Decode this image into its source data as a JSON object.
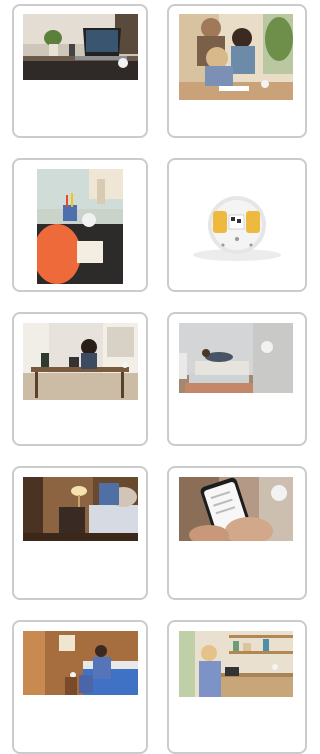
{
  "gallery": {
    "cards": [
      {
        "icon": "desk-laptop-photo",
        "alt": ""
      },
      {
        "icon": "family-homework-photo",
        "alt": ""
      },
      {
        "icon": "child-drawing-photo",
        "alt": ""
      },
      {
        "icon": "sensor-device-photo",
        "alt": ""
      },
      {
        "icon": "home-office-photo",
        "alt": ""
      },
      {
        "icon": "bedroom-resting-photo",
        "alt": ""
      },
      {
        "icon": "bedside-lamp-photo",
        "alt": ""
      },
      {
        "icon": "phone-app-photo",
        "alt": ""
      },
      {
        "icon": "bedroom-morning-photo",
        "alt": ""
      },
      {
        "icon": "kitchen-tablet-photo",
        "alt": ""
      }
    ]
  }
}
